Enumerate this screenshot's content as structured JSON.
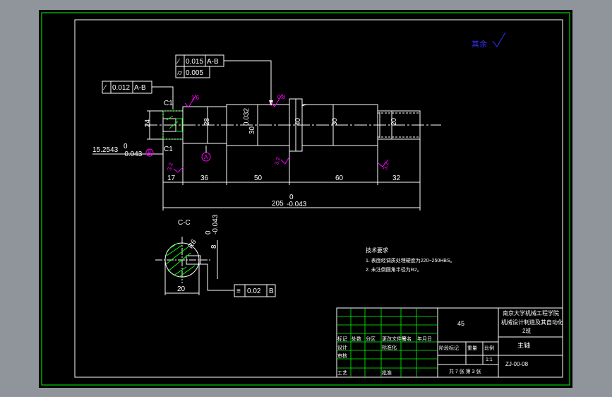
{
  "roughness_note": "其余",
  "gdt": {
    "top_row1": {
      "tol": "0.015",
      "datum": "A-B"
    },
    "top_row2": {
      "tol": "0.005"
    },
    "left": {
      "tol": "0.012",
      "datum": "A-B"
    },
    "section": {
      "tol": "0.02",
      "datum": "B"
    }
  },
  "chamfer": "C1",
  "datums": {
    "a": "A",
    "b": "B"
  },
  "dims": {
    "d24": "24",
    "d28": "28",
    "d30_tol": "30",
    "d30_sub": "0.032",
    "d40": "40",
    "d30b": "30",
    "d20": "20",
    "l17": "17",
    "l36": "36",
    "l50": "50",
    "l60": "60",
    "l32": "32",
    "total": "205",
    "total_upper": "0",
    "total_lower": "-0.043",
    "key_len": "15.2543",
    "key_upper": "0",
    "key_lower": "-0.043"
  },
  "roughness": {
    "r1": "1.6",
    "r2": "0.8",
    "r3": "3.2",
    "r4": "3.2",
    "r5": "3.2",
    "r6": "3.2"
  },
  "section_view": {
    "label": "C-C",
    "r": "R6",
    "slot": "8",
    "slot_tol_upper": "0",
    "slot_tol_lower": "-0.043",
    "width": "20"
  },
  "tech_req": {
    "title": "技术要求",
    "items": [
      "1. 表面经调质处理硬度为220~250HBS。",
      "2. 未注倒圆角半径为R2。"
    ]
  },
  "title_block": {
    "school": "南京大学机械工程学院",
    "course": "机械设计制造及其自动化",
    "class": "2班",
    "part_name": "主轴",
    "material": "45",
    "drawing_no": "ZJ-00-08",
    "sheet_info": "共 7 张 第 3 张",
    "ratio": "1:1",
    "labels": {
      "mark": "标记",
      "count": "处数",
      "zone": "分区",
      "doc": "更改文件号",
      "sign": "签名",
      "date": "年月日",
      "design": "设计",
      "check": "审核",
      "craft": "工艺",
      "approve": "批准",
      "std": "标准化",
      "stage": "阶段标记",
      "weight": "重量",
      "scale": "比例"
    }
  },
  "colors": {
    "frame_outer": "#00ff00",
    "frame_inner": "#ffffff",
    "background": "#000000",
    "dim": "#ffffff",
    "roughness": "#ff00ff",
    "hatch": "#00ff00",
    "note": "#3333ff"
  }
}
